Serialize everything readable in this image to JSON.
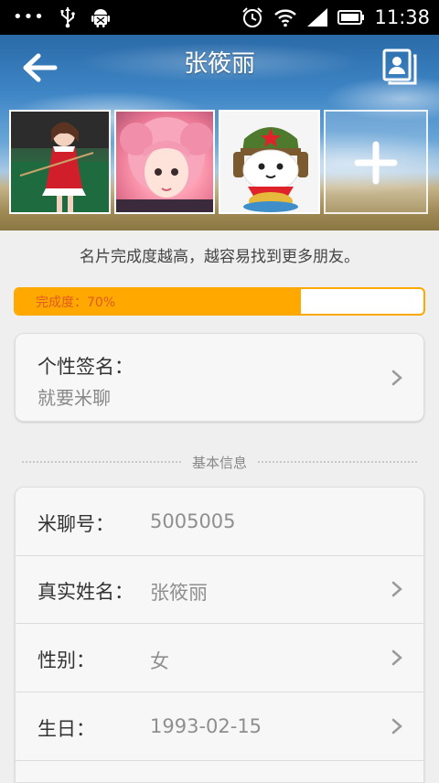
{
  "status_bar": {
    "time": "11:38",
    "icons": [
      "more-dots-icon",
      "usb-icon",
      "android-debug-icon",
      "alarm-icon",
      "wifi-icon",
      "signal-icon",
      "battery-icon"
    ]
  },
  "header": {
    "title": "张筱丽",
    "back_icon": "arrow-left-icon",
    "contact_icon": "contact-card-icon",
    "add_photo_icon": "plus-icon"
  },
  "hint": "名片完成度越高，越容易找到更多朋友。",
  "progress": {
    "label": "完成度：70%",
    "value": 0.7,
    "color": "#ffa800"
  },
  "signature": {
    "label": "个性签名：",
    "value": "就要米聊"
  },
  "section": {
    "title": "基本信息"
  },
  "basic_info": [
    {
      "label": "米聊号：",
      "value": "5005005"
    },
    {
      "label": "真实姓名：",
      "value": "张筱丽"
    },
    {
      "label": "性别：",
      "value": "女"
    },
    {
      "label": "生日：",
      "value": "1993-02-15"
    }
  ]
}
